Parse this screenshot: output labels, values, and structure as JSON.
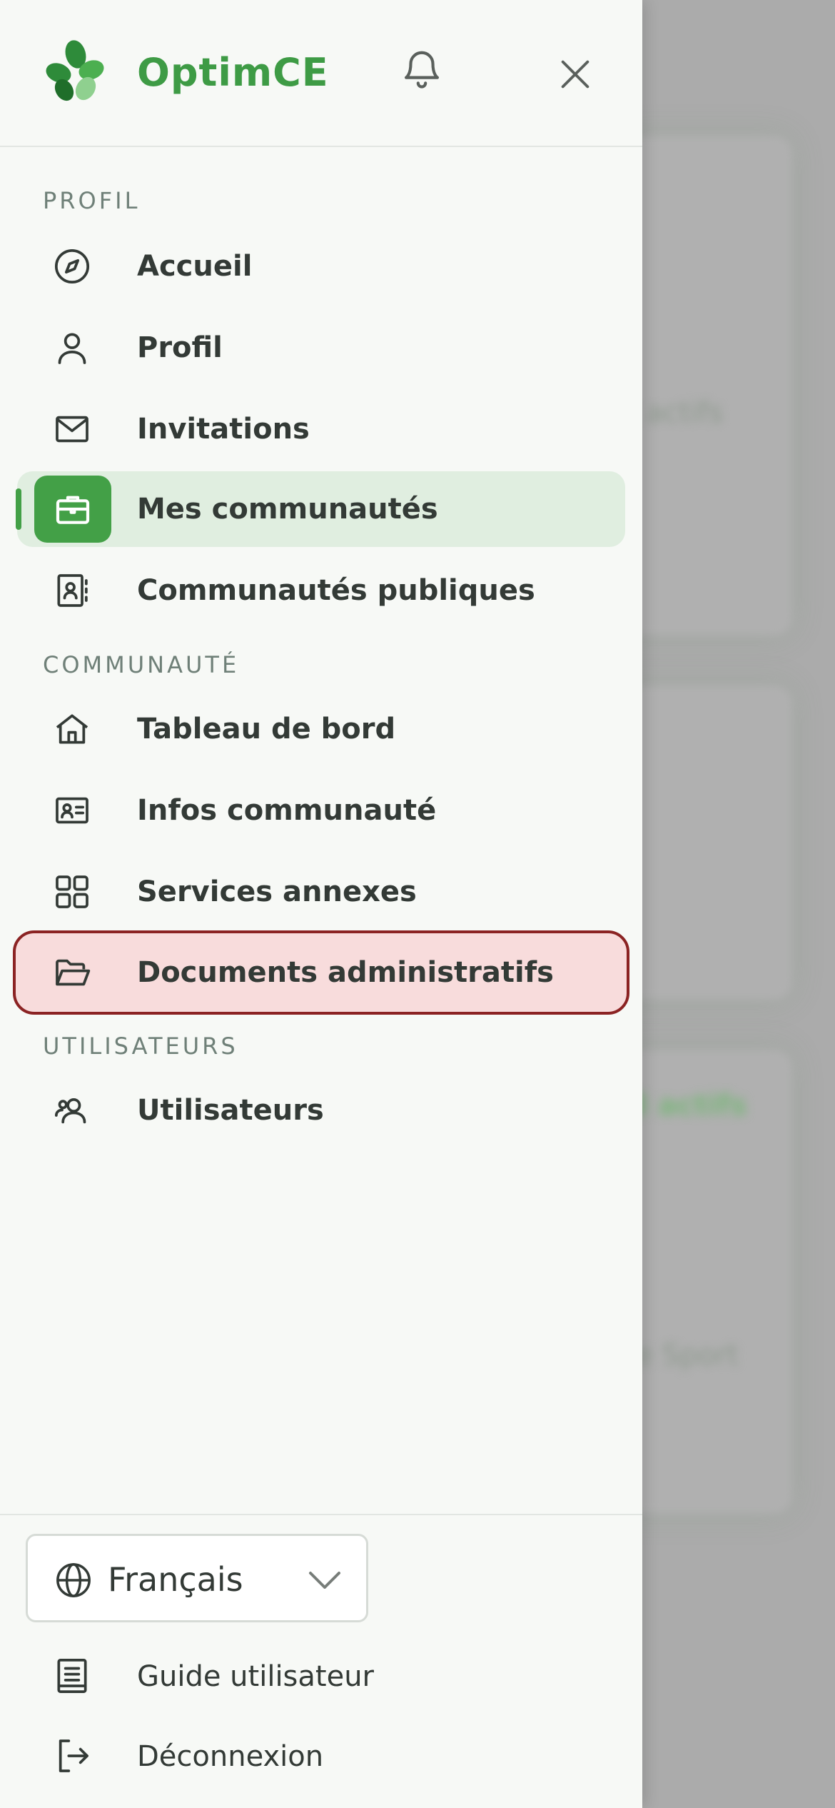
{
  "app": {
    "brand": "OptimCE"
  },
  "background": {
    "text_1": "actifs",
    "text_2": "8 actifs",
    "text_3": "e Sport"
  },
  "sections": {
    "profil": "PROFIL",
    "communaute": "COMMUNAUTÉ",
    "utilisateurs": "UTILISATEURS"
  },
  "nav": {
    "accueil": "Accueil",
    "profil": "Profil",
    "invitations": "Invitations",
    "mes_communautes": "Mes communautés",
    "communautes_publiques": "Communautés publiques",
    "tableau_de_bord": "Tableau de bord",
    "infos_communaute": "Infos communauté",
    "services_annexes": "Services annexes",
    "documents_administratifs": "Documents administratifs",
    "utilisateurs": "Utilisateurs"
  },
  "footer": {
    "language": "Français",
    "guide": "Guide utilisateur",
    "logout": "Déconnexion"
  },
  "colors": {
    "brand_green": "#3e9b45",
    "active_bg": "#e0eee0",
    "highlight_border": "#8b2323",
    "highlight_bg": "#f8dcdc"
  }
}
